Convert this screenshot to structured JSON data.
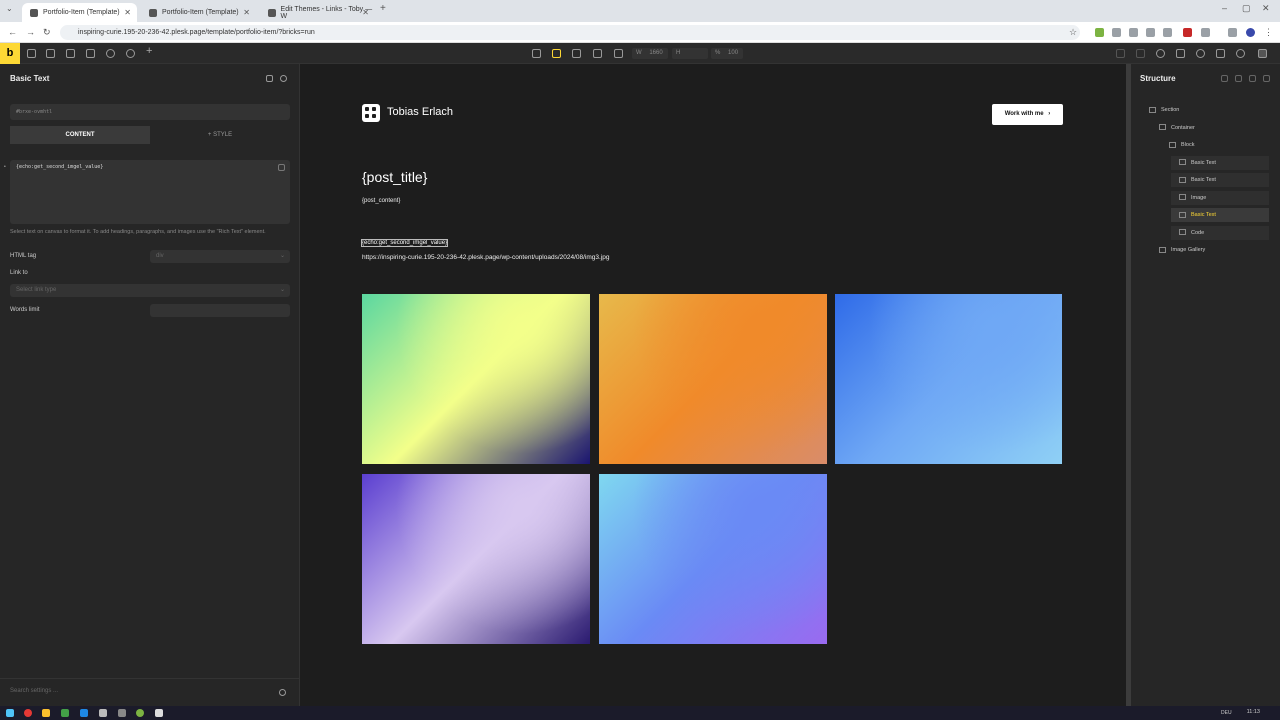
{
  "browser": {
    "tabs": [
      {
        "label": "Portfolio-Item (Template)"
      },
      {
        "label": "Portfolio-Item (Template)"
      },
      {
        "label": "Edit Themes - Links - Toby — W"
      }
    ],
    "url": "inspiring-curie.195-20-236-42.plesk.page/template/portfolio-item/?bricks=run"
  },
  "toolbar": {
    "logo": "b",
    "width_label": "W",
    "width_value": "1660",
    "height_label": "H",
    "zoom_label": "%",
    "zoom_value": "100"
  },
  "left_panel": {
    "title": "Basic Text",
    "element_id": "#brxe-ovmhtl",
    "tab_content": "CONTENT",
    "tab_style": "+ STYLE",
    "text_value": "{echo:get_second_imgel_value}",
    "help": "Select text on canvas to format it. To add headings, paragraphs, and images use the \"Rich Text\" element.",
    "html_tag_label": "HTML tag",
    "html_tag_value": "div",
    "link_label": "Link to",
    "link_placeholder": "Select link type",
    "words_limit_label": "Words limit",
    "search_placeholder": "Search settings ..."
  },
  "canvas": {
    "brand_name": "Tobias Erlach",
    "cta": "Work with me",
    "cta_arrow": "›",
    "post_title": "{post_title}",
    "post_content": "{post_content}",
    "echo_text": "{echo:get_second_imgel_value}",
    "image_url": "https://inspiring-curie.195-20-236-42.plesk.page/wp-content/uploads/2024/08/img3.jpg",
    "gallery_colors": [
      [
        "#5bd7a0",
        "#f3ff8a",
        "#1a1470"
      ],
      [
        "#e7b94b",
        "#f08a2a",
        "#d98c6a"
      ],
      [
        "#2f6be8",
        "#6fa8f5",
        "#8fd0f5"
      ],
      [
        "#5b3fd0",
        "#d8c8f0",
        "#2a1a70"
      ],
      [
        "#7fd8f0",
        "#6a8af5",
        "#9a6af0"
      ]
    ]
  },
  "structure": {
    "title": "Structure",
    "nodes": [
      {
        "label": "Section",
        "depth": 0
      },
      {
        "label": "Container",
        "depth": 1
      },
      {
        "label": "Block",
        "depth": 2
      },
      {
        "label": "Basic Text",
        "depth": 3
      },
      {
        "label": "Basic Text",
        "depth": 3
      },
      {
        "label": "Image",
        "depth": 3
      },
      {
        "label": "Basic Text",
        "depth": 3,
        "active": true
      },
      {
        "label": "Code",
        "depth": 3
      },
      {
        "label": "Image Gallery",
        "depth": 1
      }
    ]
  },
  "taskbar": {
    "lang": "DEU",
    "time": "11:13"
  }
}
